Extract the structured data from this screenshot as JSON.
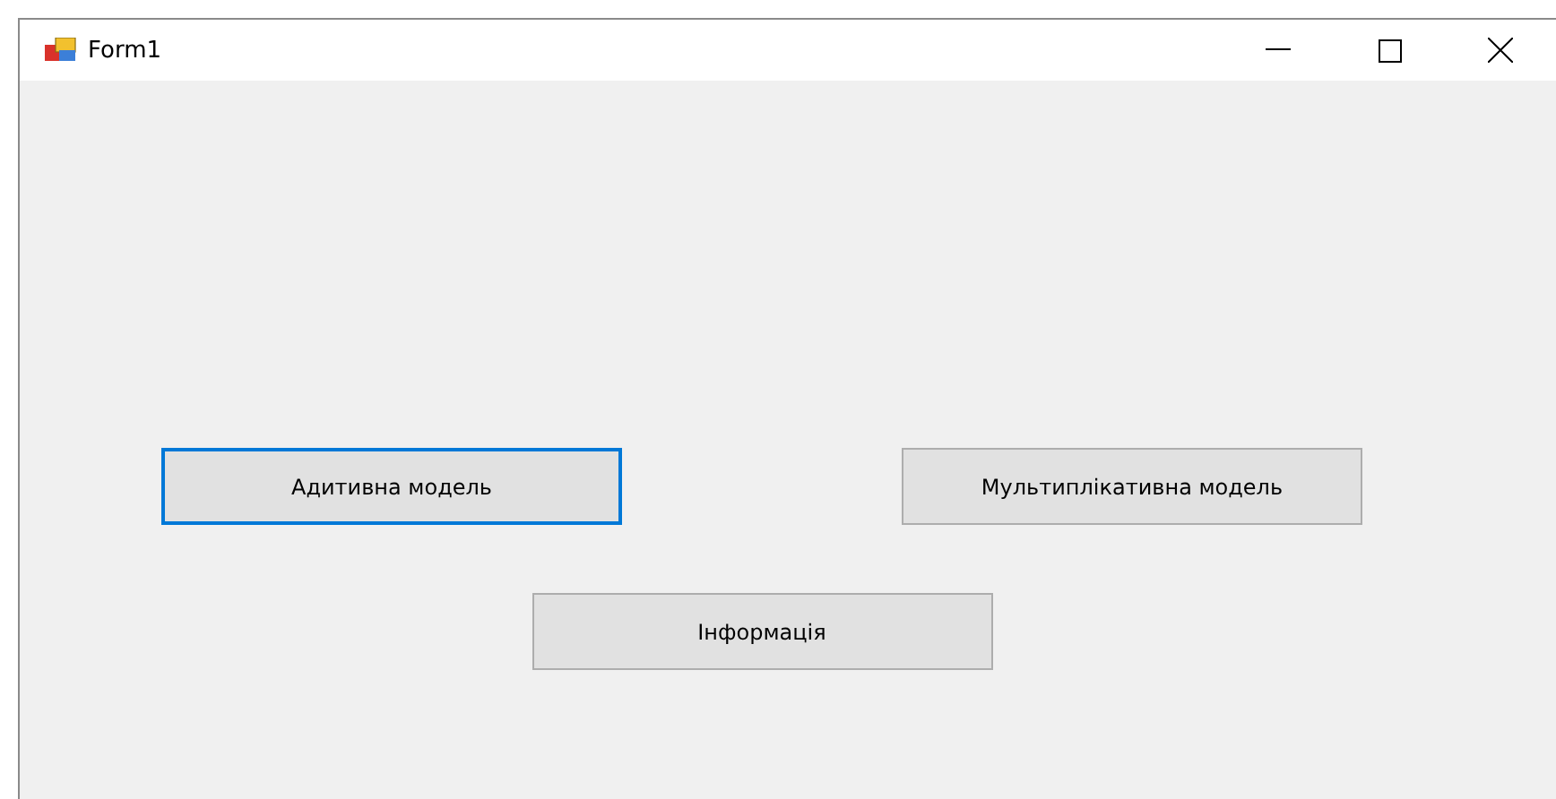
{
  "window": {
    "title": "Form1"
  },
  "buttons": [
    {
      "label": "Адитивна модель",
      "focused": true
    },
    {
      "label": "Мультиплікативна модель",
      "focused": false
    },
    {
      "label": "Інформація",
      "focused": false
    }
  ]
}
